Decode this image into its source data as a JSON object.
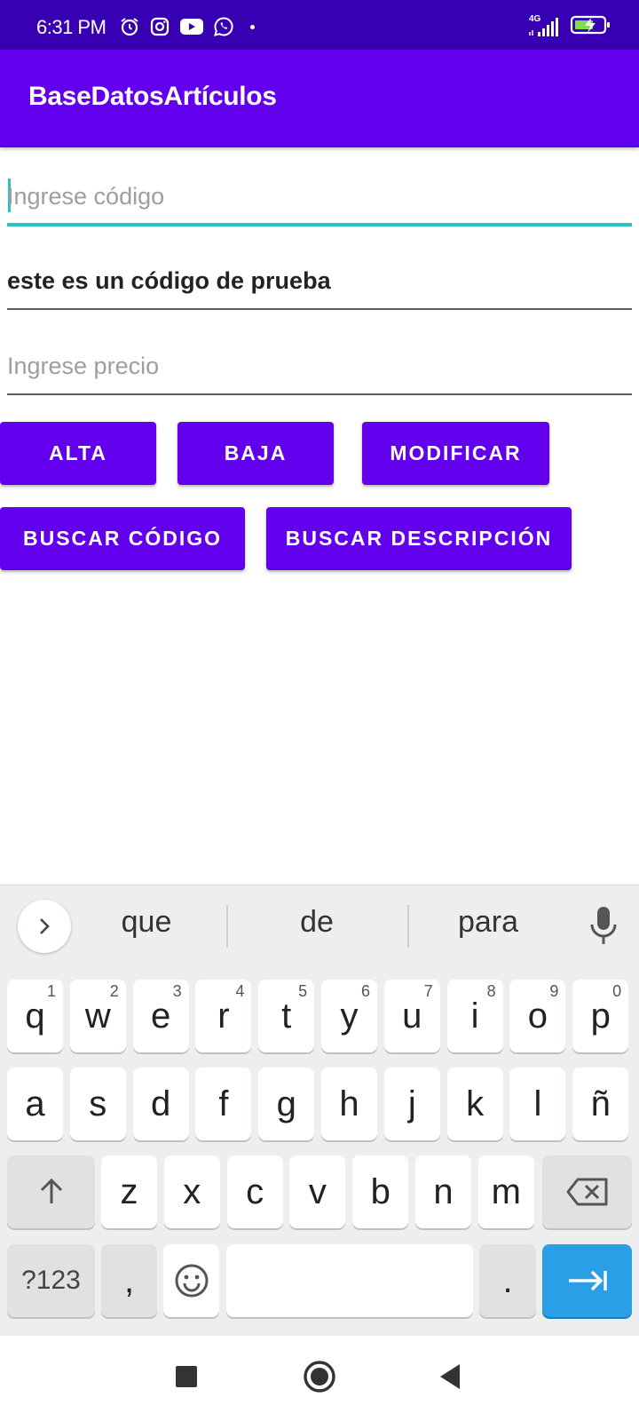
{
  "status_bar": {
    "time": "6:31 PM",
    "network": "4G",
    "left_icons": [
      "alarm-icon",
      "instagram-icon",
      "youtube-icon",
      "whatsapp-icon"
    ],
    "right_icons": [
      "signal-icon",
      "battery-charging-icon"
    ]
  },
  "app_bar": {
    "title": "BaseDatosArtículos"
  },
  "form": {
    "codigo": {
      "placeholder": "Ingrese código",
      "value": ""
    },
    "descripcion": {
      "value": "este es un código de prueba"
    },
    "precio": {
      "placeholder": "Ingrese precio",
      "value": ""
    }
  },
  "buttons": {
    "alta": "ALTA",
    "baja": "BAJA",
    "modificar": "MODIFICAR",
    "buscar_codigo": "BUSCAR CÓDIGO",
    "buscar_descripcion": "BUSCAR DESCRIPCIÓN"
  },
  "keyboard": {
    "suggestions": [
      "que",
      "de",
      "para"
    ],
    "row1": [
      {
        "k": "q",
        "h": "1"
      },
      {
        "k": "w",
        "h": "2"
      },
      {
        "k": "e",
        "h": "3"
      },
      {
        "k": "r",
        "h": "4"
      },
      {
        "k": "t",
        "h": "5"
      },
      {
        "k": "y",
        "h": "6"
      },
      {
        "k": "u",
        "h": "7"
      },
      {
        "k": "i",
        "h": "8"
      },
      {
        "k": "o",
        "h": "9"
      },
      {
        "k": "p",
        "h": "0"
      }
    ],
    "row2": [
      "a",
      "s",
      "d",
      "f",
      "g",
      "h",
      "j",
      "k",
      "l",
      "ñ"
    ],
    "row3": [
      "z",
      "x",
      "c",
      "v",
      "b",
      "n",
      "m"
    ],
    "symbols_label": "?123",
    "comma": ",",
    "period": "."
  },
  "colors": {
    "status_bar": "#3700b3",
    "primary": "#6200ee",
    "accent": "#26c6c0",
    "enter_key": "#2a9ee6"
  }
}
